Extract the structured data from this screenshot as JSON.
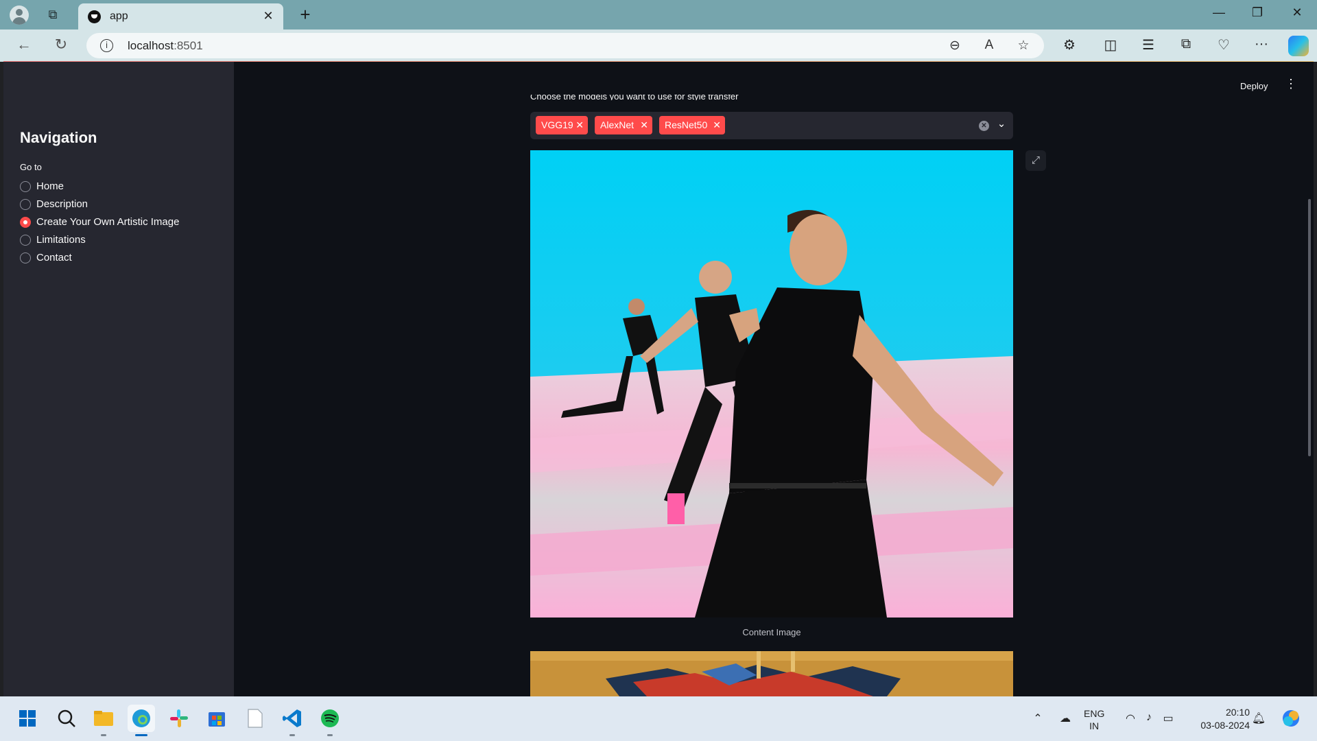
{
  "browser": {
    "tab_title": "app",
    "url_host": "localhost",
    "url_port": ":8501",
    "colors": {
      "frame": "#76a5ad",
      "tab": "#d5e5e8"
    }
  },
  "sidebar": {
    "title": "Navigation",
    "radio_label": "Go to",
    "options": [
      {
        "label": "Home",
        "selected": false
      },
      {
        "label": "Description",
        "selected": false
      },
      {
        "label": "Create Your Own Artistic Image",
        "selected": true
      },
      {
        "label": "Limitations",
        "selected": false
      },
      {
        "label": "Contact",
        "selected": false
      }
    ]
  },
  "header": {
    "deploy_label": "Deploy",
    "menu_icon": "kebab-menu-icon"
  },
  "main": {
    "multiselect_label": "Choose the models you want to use for style transfer",
    "selected_models": [
      "VGG19",
      "AlexNet",
      "ResNet50"
    ],
    "content_image_caption": "Content Image"
  },
  "taskbar": {
    "language": "ENG",
    "region": "IN",
    "time": "20:10",
    "date": "03-08-2024"
  },
  "theme": {
    "accent": "#ff4b4b",
    "app_bg": "#0e1117",
    "sidebar_bg": "#262730"
  }
}
